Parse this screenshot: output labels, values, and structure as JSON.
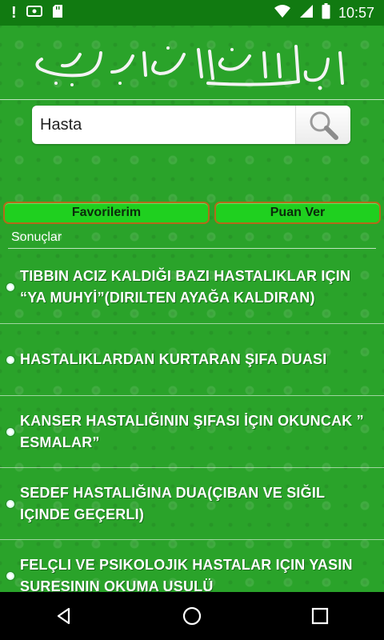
{
  "status_bar": {
    "time": "10:57",
    "icons": [
      "alert-icon",
      "screencast-icon",
      "sd-card-icon",
      "wifi-icon",
      "signal-icon",
      "battery-icon"
    ]
  },
  "search": {
    "value": "Hasta",
    "icon": "search-icon"
  },
  "buttons": {
    "favorites": "Favorilerim",
    "rate": "Puan Ver"
  },
  "results_label": "Sonuçlar",
  "results": [
    {
      "text": "TIBBIN ACIZ KALDIĞI BAZI HASTALIKLAR IÇIN “YA MUHYİ”(DIRILTEN AYAĞA KALDIRAN)"
    },
    {
      "text": "HASTALIKLARDAN KURTARAN ŞIFA DUASI"
    },
    {
      "text": "KANSER HASTALIĞININ ŞIFASI İÇIN OKUNCAK ” ESMALAR”"
    },
    {
      "text": "SEDEF HASTALIĞINA DUA(ÇIBAN VE SIĞIL IÇINDE GEÇERLI)"
    },
    {
      "text": "FELÇLI VE PSIKOLOJIK HASTALAR IÇIN YASIN SURESININ OKUMA USULÜ"
    }
  ],
  "nav": {
    "icons": [
      "back-icon",
      "home-icon",
      "recents-icon"
    ]
  },
  "colors": {
    "status_bar": "#117a11",
    "background": "#2aa32a",
    "button_fill": "#1fd01f",
    "button_border": "#b36a1a"
  }
}
